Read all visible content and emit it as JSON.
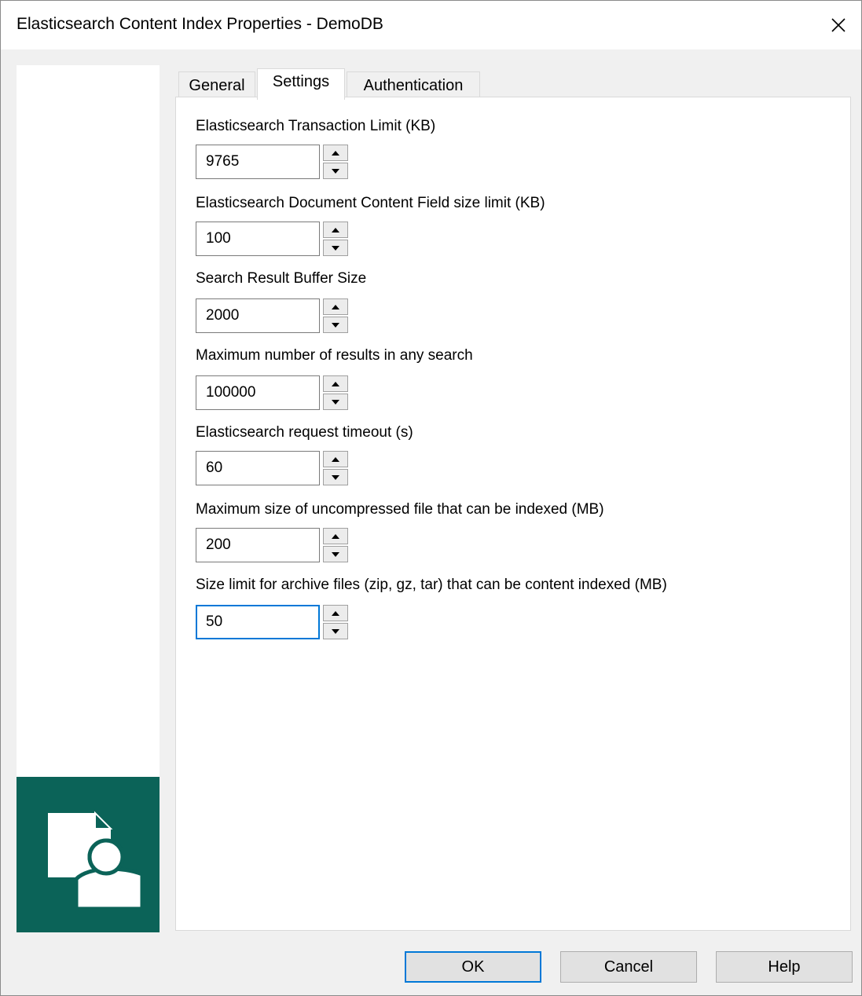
{
  "window": {
    "title": "Elasticsearch Content Index Properties - DemoDB"
  },
  "tabs": [
    {
      "label": "General",
      "active": false
    },
    {
      "label": "Settings",
      "active": true
    },
    {
      "label": "Authentication",
      "active": false
    }
  ],
  "fields": [
    {
      "label": "Elasticsearch Transaction Limit (KB)",
      "value": "9765"
    },
    {
      "label": "Elasticsearch Document Content Field size limit (KB)",
      "value": "100"
    },
    {
      "label": "Search Result Buffer Size",
      "value": "2000"
    },
    {
      "label": "Maximum number of results in any search",
      "value": "100000"
    },
    {
      "label": "Elasticsearch request timeout (s)",
      "value": "60"
    },
    {
      "label": "Maximum size of uncompressed file that can be indexed (MB)",
      "value": "200"
    },
    {
      "label": "Size limit for archive files (zip, gz, tar) that can be content indexed (MB)",
      "value": "50",
      "focused": true
    }
  ],
  "buttons": {
    "ok": "OK",
    "cancel": "Cancel",
    "help": "Help"
  },
  "icons": {
    "close": "close-icon",
    "logo": "content-index-logo-icon",
    "spin_up": "spin-up-arrow-icon",
    "spin_down": "spin-down-arrow-icon"
  },
  "colors": {
    "logo_background": "#0b6358",
    "focus_accent": "#0078d7"
  }
}
